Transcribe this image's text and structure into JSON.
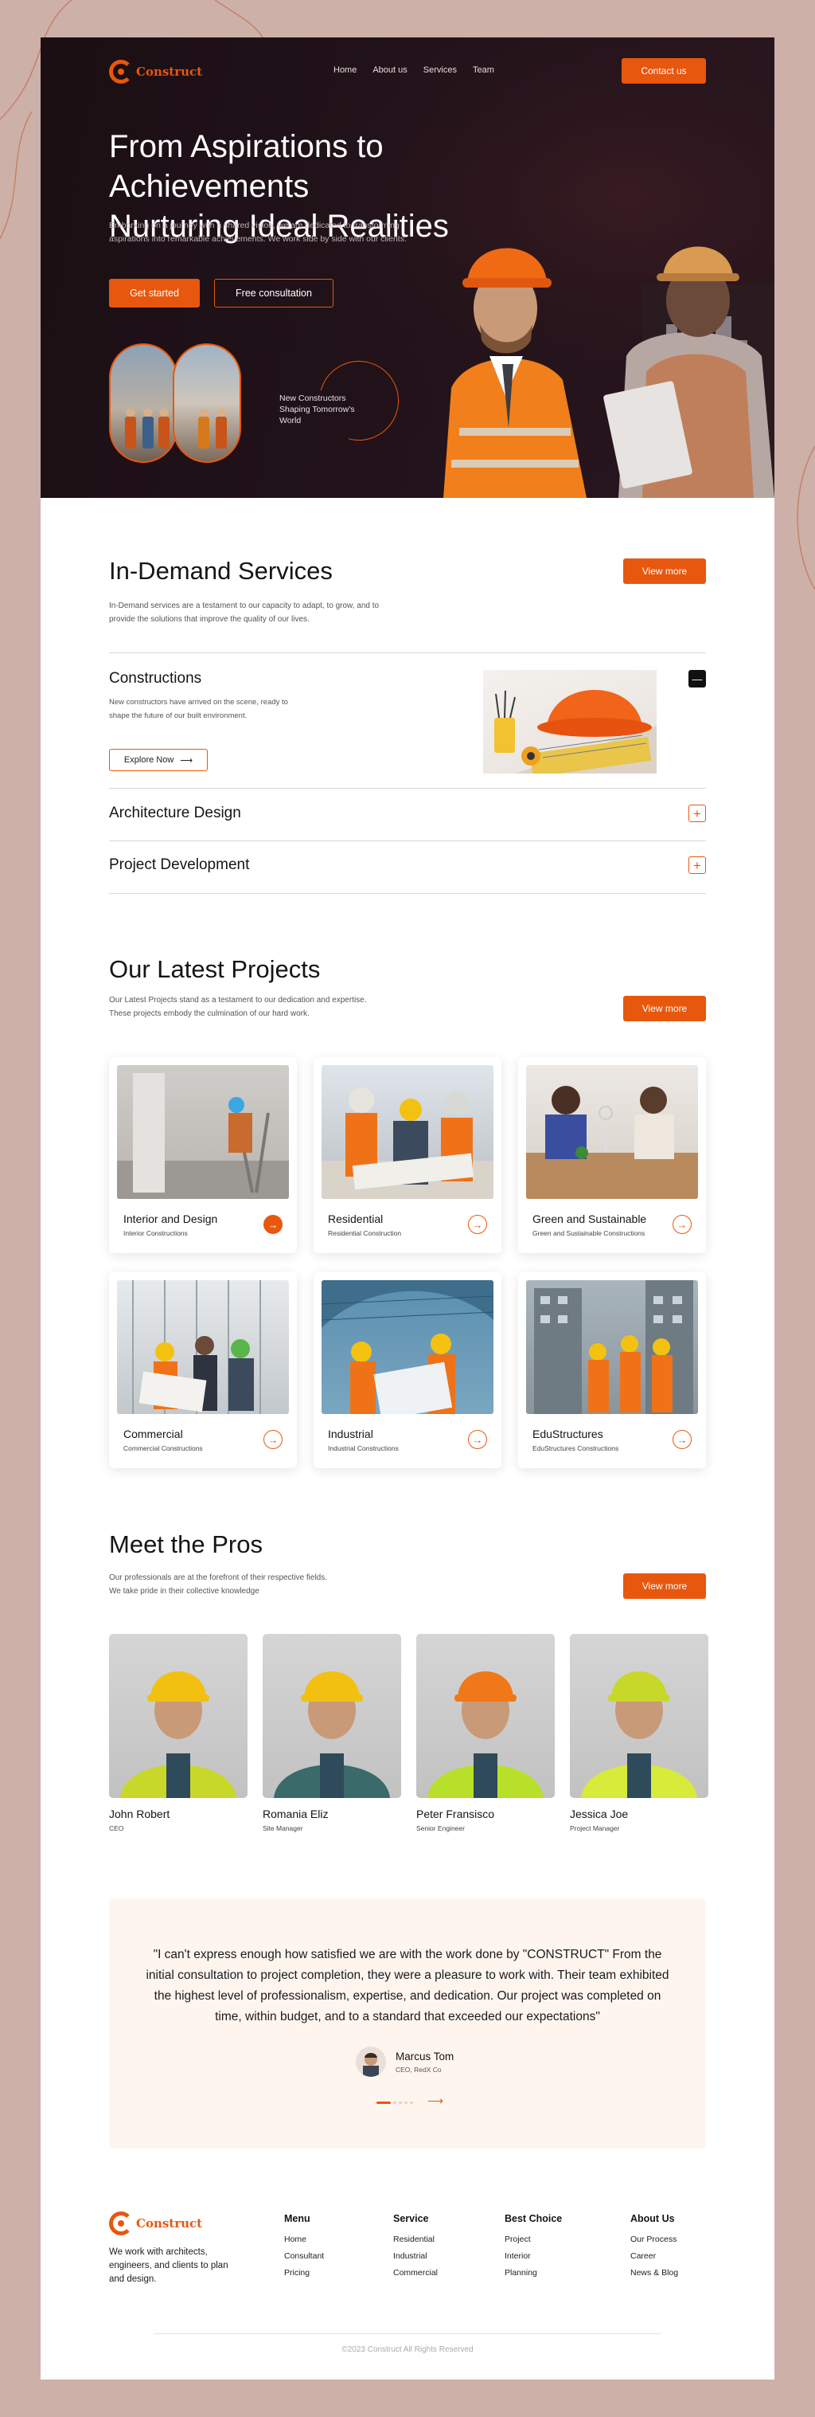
{
  "brand": {
    "name": "Construct",
    "accent": "#e8570e"
  },
  "nav": {
    "links": [
      "Home",
      "About us",
      "Services",
      "Team"
    ],
    "cta": "Contact us"
  },
  "hero": {
    "title_line1": "From Aspirations to Achievements",
    "title_line2": "Nurturing Ideal Realities",
    "subtitle": "Embarking on a journey with a shared vision, we are dedicated to transforming aspirations into remarkable achievements. We work side by side with our clients.",
    "primary_button": "Get started",
    "secondary_button": "Free consultation",
    "tagline": "New Constructors Shaping Tomorrow's World"
  },
  "services": {
    "title": "In-Demand Services",
    "subtitle": "In-Demand services are a testament to our capacity to adapt, to grow, and to provide the solutions that improve the quality of our lives.",
    "view_more": "View more",
    "items": [
      {
        "title": "Constructions",
        "description": "New constructors have arrived on the scene, ready to shape the future of our built environment.",
        "button": "Explore Now",
        "expanded": true
      },
      {
        "title": "Architecture Design",
        "expanded": false
      },
      {
        "title": "Project Development",
        "expanded": false
      }
    ]
  },
  "projects": {
    "title": "Our Latest Projects",
    "subtitle": "Our Latest Projects stand as a testament to our dedication and expertise. These projects embody the culmination of our hard work.",
    "view_more": "View more",
    "items": [
      {
        "name": "Interior and Design",
        "category": "Interior Constructions",
        "active": true
      },
      {
        "name": "Residential",
        "category": "Residential Construction",
        "active": false
      },
      {
        "name": "Green and Sustainable",
        "category": "Green and Sustainable Constructions",
        "active": false
      },
      {
        "name": "Commercial",
        "category": "Commercial Constructions",
        "active": false
      },
      {
        "name": "Industrial",
        "category": "Industrial Constructions",
        "active": false
      },
      {
        "name": "EduStructures",
        "category": "EduStructures Constructions",
        "active": false
      }
    ]
  },
  "team": {
    "title": "Meet the Pros",
    "subtitle": "Our professionals are at the forefront of their respective fields. We take pride in their collective knowledge",
    "view_more": "View more",
    "members": [
      {
        "name": "John Robert",
        "role": "CEO",
        "helmet": "#f2c010",
        "vest": "#c8d82a"
      },
      {
        "name": "Romania Eliz",
        "role": "Site Manager",
        "helmet": "#f2c010",
        "vest": "#3a6a6a"
      },
      {
        "name": "Peter Fransisco",
        "role": "Senior Engineer",
        "helmet": "#f07818",
        "vest": "#b8e02a"
      },
      {
        "name": "Jessica Joe",
        "role": "Project Manager",
        "helmet": "#c8d82a",
        "vest": "#d8ea3a"
      }
    ]
  },
  "testimonial": {
    "quote": "\"I can't express enough how satisfied we are with the work done by \"CONSTRUCT\" From the initial consultation to project completion, they were a pleasure to work with. Their team exhibited the highest level of professionalism, expertise, and dedication. Our project was completed on time, within budget, and to a standard that exceeded our expectations\"",
    "author": "Marcus Tom",
    "author_role": "CEO, RedX Co"
  },
  "footer": {
    "description": "We work with architects, engineers, and clients to plan and design.",
    "columns": [
      {
        "heading": "Menu",
        "links": [
          "Home",
          "Consultant",
          "Pricing"
        ]
      },
      {
        "heading": "Service",
        "links": [
          "Residential",
          "Industrial",
          "Commercial"
        ]
      },
      {
        "heading": "Best Choice",
        "links": [
          "Project",
          "Interior",
          "Planning"
        ]
      },
      {
        "heading": "About Us",
        "links": [
          "Our Process",
          "Career",
          "News & Blog"
        ]
      }
    ],
    "copyright": "©2023 Construct All Rights Reserved"
  }
}
